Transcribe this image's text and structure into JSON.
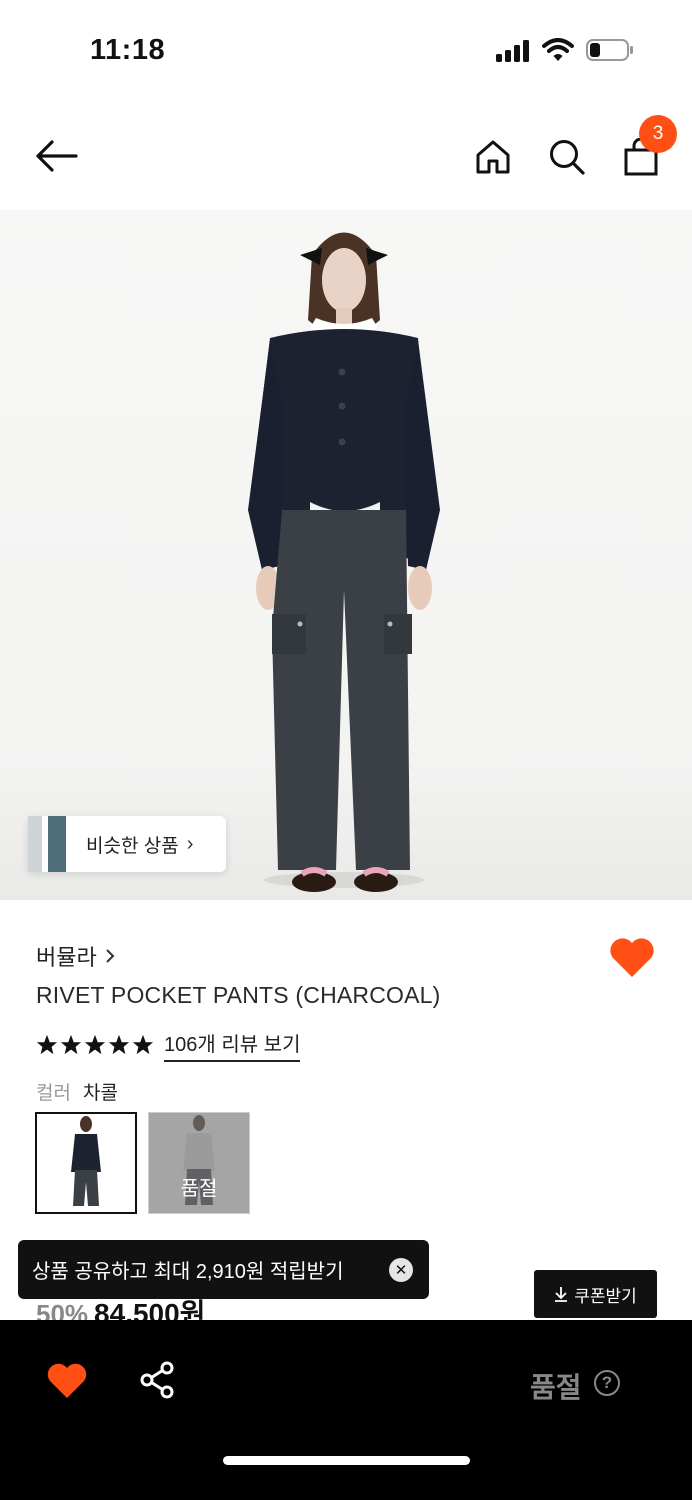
{
  "status_bar": {
    "time": "11:18"
  },
  "header": {
    "cart_count": "3"
  },
  "hero": {
    "similar_products_label": "비슷한 상품"
  },
  "product": {
    "brand": "버뮬라",
    "title": "RIVET POCKET PANTS (CHARCOAL)",
    "rating": 5,
    "review_link": "106개 리뷰 보기",
    "color_key": "컬러",
    "color_value": "차콜",
    "swatch_soldout_label": "품절",
    "discount": "50%",
    "price": "84,500원"
  },
  "toast": {
    "message": "상품 공유하고 최대 2,910원 적립받기"
  },
  "coupon": {
    "label": "쿠폰받기"
  },
  "bottom_bar": {
    "soldout_label": "품절"
  },
  "colors": {
    "accent": "#ff4f14",
    "dark": "#111111",
    "muted": "#888888"
  }
}
